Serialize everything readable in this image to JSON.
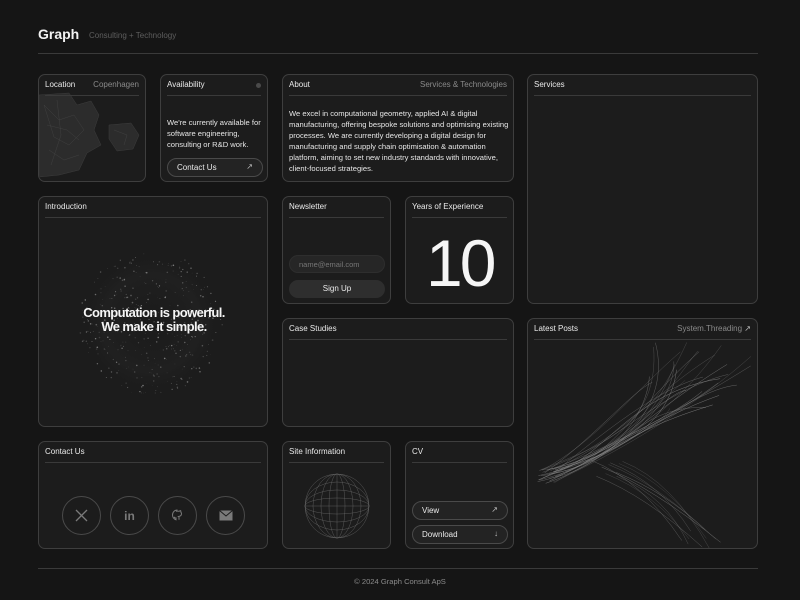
{
  "header": {
    "brand": "Graph",
    "tagline": "Consulting + Technology"
  },
  "location": {
    "title": "Location",
    "city": "Copenhagen"
  },
  "availability": {
    "title": "Availability",
    "text": "We're currently available for software engineering, consulting or R&D work.",
    "button": "Contact Us"
  },
  "about": {
    "title": "About",
    "aside": "Services & Technologies",
    "text": "We excel in computational geometry, applied AI & digital manufacturing, offering bespoke solutions and optimising existing processes. We are currently developing a digital design for manufacturing and supply chain optimisation & automation platform, aiming to set new industry standards with innovative, client-focused strategies."
  },
  "services": {
    "title": "Services"
  },
  "introduction": {
    "title": "Introduction",
    "line1": "Computation is powerful.",
    "line2": "We make it simple."
  },
  "newsletter": {
    "title": "Newsletter",
    "placeholder": "name@email.com",
    "button": "Sign Up"
  },
  "experience": {
    "title": "Years of Experience",
    "value": "10"
  },
  "case_studies": {
    "title": "Case Studies"
  },
  "latest_posts": {
    "title": "Latest Posts",
    "aside": "System.Threading"
  },
  "contact": {
    "title": "Contact Us",
    "icons": [
      "x-icon",
      "linkedin-icon",
      "github-icon",
      "email-icon"
    ]
  },
  "site_info": {
    "title": "Site Information"
  },
  "cv": {
    "title": "CV",
    "view": "View",
    "download": "Download"
  },
  "footer": {
    "copyright": "© 2024 Graph Consult ApS"
  }
}
